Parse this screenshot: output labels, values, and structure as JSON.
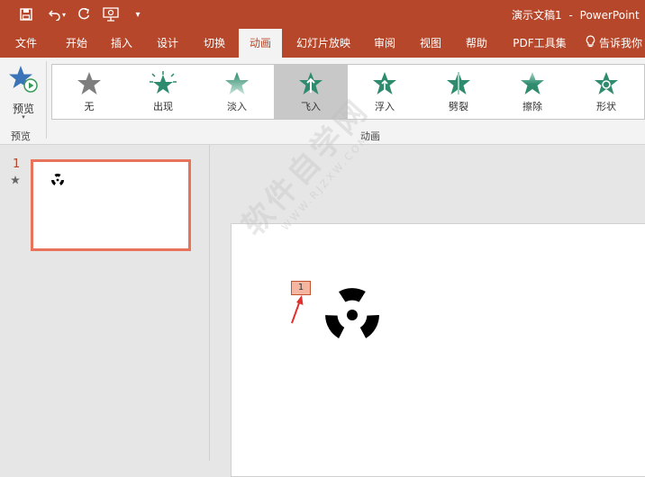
{
  "title_bar": {
    "doc_name": "演示文稿1",
    "separator": "-",
    "app_name": "PowerPoint",
    "qat_icons": [
      "save-icon",
      "undo-icon",
      "redo-icon",
      "slideshow-start-icon",
      "customize-qat-icon"
    ]
  },
  "tabs": [
    {
      "label": "文件",
      "active": false
    },
    {
      "label": "开始",
      "active": false
    },
    {
      "label": "插入",
      "active": false
    },
    {
      "label": "设计",
      "active": false
    },
    {
      "label": "切换",
      "active": false
    },
    {
      "label": "动画",
      "active": true
    },
    {
      "label": "幻灯片放映",
      "active": false
    },
    {
      "label": "审阅",
      "active": false
    },
    {
      "label": "视图",
      "active": false
    },
    {
      "label": "帮助",
      "active": false
    },
    {
      "label": "PDF工具集",
      "active": false
    },
    {
      "label": "告诉我你",
      "active": false,
      "icon": "lightbulb-icon"
    }
  ],
  "ribbon": {
    "preview": {
      "button_label": "预览",
      "group_label": "预览",
      "icon": "preview-star-icon"
    },
    "animations_group_label": "动画",
    "gallery": [
      {
        "label": "无",
        "icon": "star-none-icon",
        "selected": false
      },
      {
        "label": "出现",
        "icon": "star-appear-icon",
        "selected": false
      },
      {
        "label": "淡入",
        "icon": "star-fade-icon",
        "selected": false
      },
      {
        "label": "飞入",
        "icon": "star-fly-in-icon",
        "selected": true
      },
      {
        "label": "浮入",
        "icon": "star-float-in-icon",
        "selected": false
      },
      {
        "label": "劈裂",
        "icon": "star-split-icon",
        "selected": false
      },
      {
        "label": "擦除",
        "icon": "star-wipe-icon",
        "selected": false
      },
      {
        "label": "形状",
        "icon": "star-shape-icon",
        "selected": false
      }
    ]
  },
  "thumbnails": [
    {
      "number": "1",
      "has_animation": true,
      "animation_icon": "animation-star-icon"
    }
  ],
  "slide": {
    "animation_tag": "1",
    "shape_icon": "radiation-symbol-icon"
  },
  "watermark": {
    "main": "软件自学网",
    "sub": "WWW.RJZXW.COM"
  },
  "colors": {
    "accent": "#b7472a",
    "ribbon_bg": "#f3f3f3",
    "gallery_selected": "#c8c8c8",
    "thumbnail_border": "#e8735a",
    "tag_fill": "#f4b6a0",
    "arrow": "#e03030"
  }
}
